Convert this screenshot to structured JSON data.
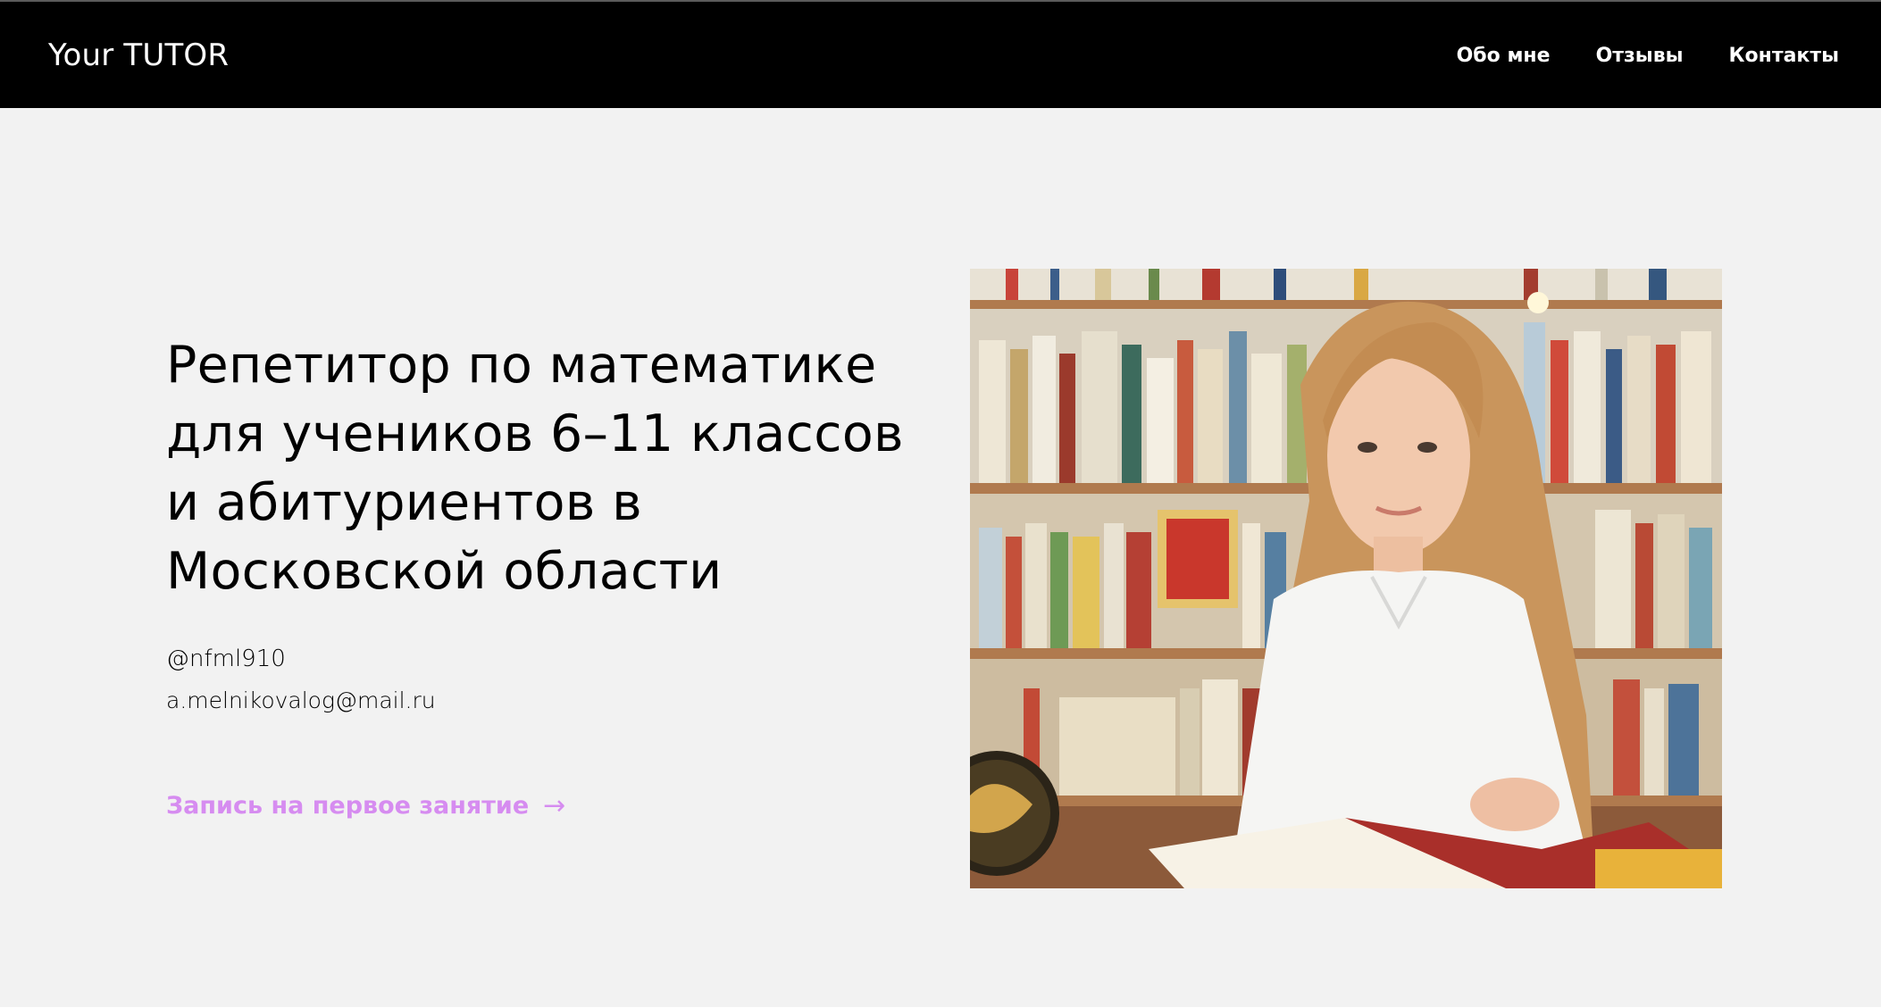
{
  "header": {
    "brand": "Your TUTOR",
    "nav": [
      {
        "label": "Обо мне"
      },
      {
        "label": "Отзывы"
      },
      {
        "label": "Контакты"
      }
    ]
  },
  "hero": {
    "headline": "Репетитор по математике для учеников 6–11 классов и абитуриентов в Московской области",
    "telegram": "@nfml910",
    "email": "a.melnikovalog@mail.ru",
    "cta_label": "Запись на первое занятие",
    "cta_arrow": "→"
  },
  "colors": {
    "header_bg": "#000000",
    "page_bg": "#f2f2f2",
    "accent": "#d68cf0",
    "text": "#000000"
  },
  "photo": {
    "icon": "tutor-portrait-photo"
  }
}
